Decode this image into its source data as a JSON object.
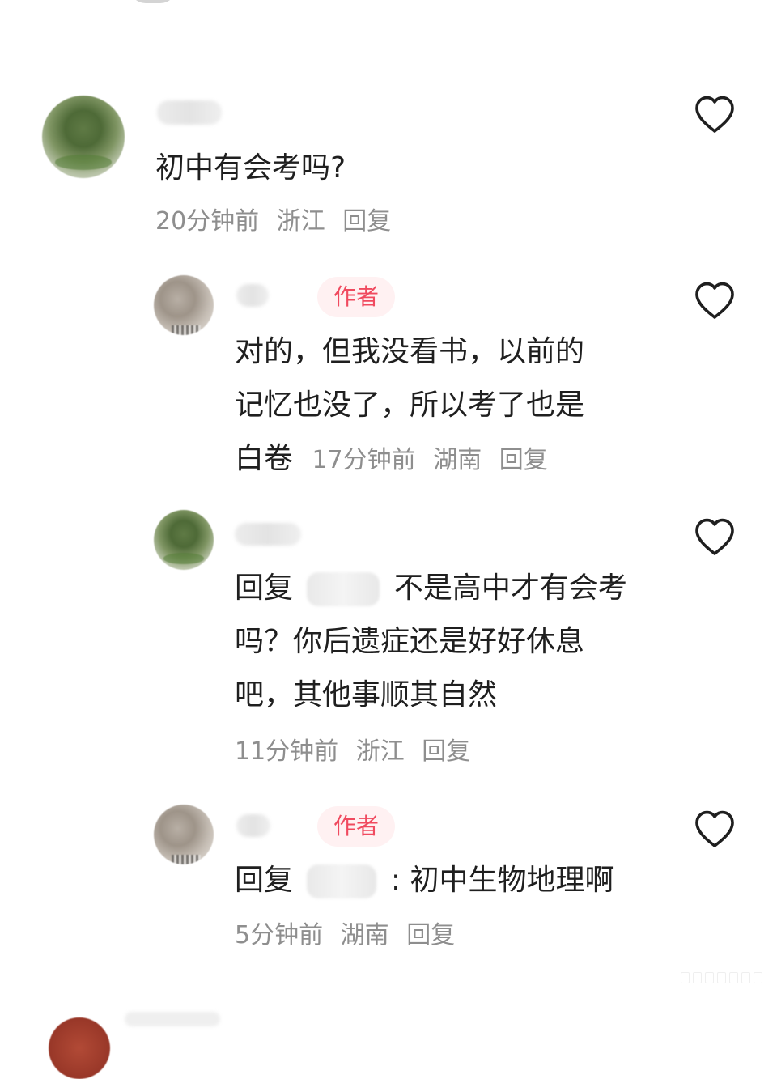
{
  "comments": [
    {
      "text": "初中有会考吗?",
      "meta": {
        "time": "20分钟前",
        "location": "浙江",
        "reply": "回复"
      }
    },
    {
      "author_badge": "作者",
      "lines": [
        "对的，但我没看书，以前的",
        "记忆也没了，所以考了也是",
        "白卷"
      ],
      "meta": {
        "time": "17分钟前",
        "location": "湖南",
        "reply": "回复"
      }
    },
    {
      "line1_prefix": "回复",
      "line1_suffix": "不是高中才有会考",
      "line2": "吗？你后遗症还是好好休息",
      "line3": "吧，其他事顺其自然",
      "meta": {
        "time": "11分钟前",
        "location": "浙江",
        "reply": "回复"
      }
    },
    {
      "author_badge": "作者",
      "line1_prefix": "回复",
      "line1_suffix": ": 初中生物地理啊",
      "meta": {
        "time": "5分钟前",
        "location": "湖南",
        "reply": "回复"
      }
    }
  ],
  "icons": {
    "like": "heart-outline-icon",
    "badge": "author-badge"
  },
  "colors": {
    "text": "#1f1f1f",
    "meta": "#8e8e8e",
    "badge_bg": "#fff1f2",
    "badge_text": "#f04a5f",
    "icon": "#1f1f1f"
  }
}
